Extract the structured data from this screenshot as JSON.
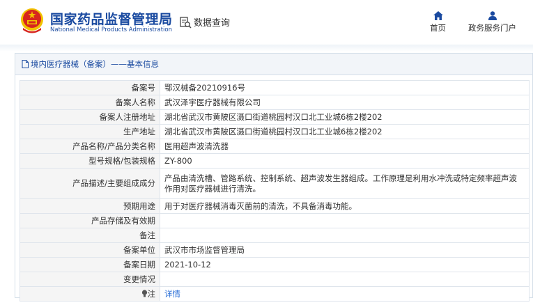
{
  "header": {
    "title_cn": "国家药品监督管理局",
    "title_en": "National Medical Products Administration",
    "query_label": "数据查询",
    "nav": [
      {
        "label": "首页",
        "icon": "home-icon"
      },
      {
        "label": "政务服务门户",
        "icon": "user-icon"
      }
    ]
  },
  "breadcrumb": "境内医疗器械（备案）——基本信息",
  "record": [
    {
      "key": "备案号",
      "value": "鄂汉械备20210916号"
    },
    {
      "key": "备案人名称",
      "value": "武汉泽宇医疗器械有限公司"
    },
    {
      "key": "备案人注册地址",
      "value": "湖北省武汉市黄陂区滠口街道桃园村汉口北工业城6栋2楼202"
    },
    {
      "key": "生产地址",
      "value": "湖北省武汉市黄陂区滠口街道桃园村汉口北工业城6栋2楼202"
    },
    {
      "key": "产品名称/产品分类名称",
      "value": "医用超声波清洗器"
    },
    {
      "key": "型号规格/包装规格",
      "value": "ZY-800"
    },
    {
      "key": "产品描述/主要组成成分",
      "value": "产品由清洗槽、管路系统、控制系统、超声波发生器组成。工作原理是利用水冲洗或特定频率超声波作用对医疗器械进行清洗。"
    },
    {
      "key": "预期用途",
      "value": "用于对医疗器械消毒灭菌前的清洗，不具备消毒功能。"
    },
    {
      "key": "产品存储及有效期",
      "value": ""
    },
    {
      "key": "备注",
      "value": ""
    },
    {
      "key": "备案单位",
      "value": "武汉市市场监督管理局"
    },
    {
      "key": "备案日期",
      "value": "2021-10-12"
    },
    {
      "key": "变更情况",
      "value": ""
    }
  ],
  "note": {
    "key": "注",
    "link": "详情"
  },
  "colors": {
    "brand_blue": "#1a4aa0",
    "link_blue": "#2a6ed6",
    "emblem_red": "#d7261e",
    "emblem_gold": "#f2c200"
  }
}
